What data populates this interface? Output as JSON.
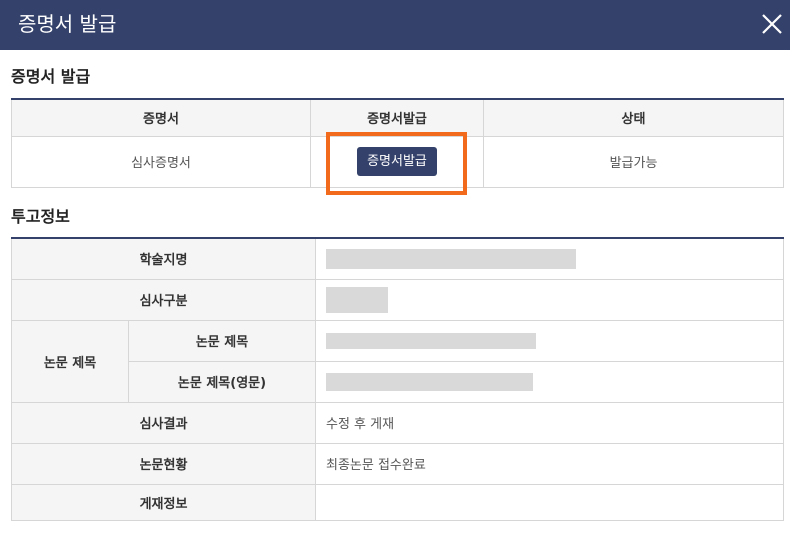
{
  "window": {
    "title": "증명서 발급",
    "close_icon": "close-icon"
  },
  "certificate_section": {
    "title": "증명서 발급",
    "headers": [
      "증명서",
      "증명서발급",
      "상태"
    ],
    "row": {
      "certificate": "심사증명서",
      "issue_button": "증명서발급",
      "status": "발급가능"
    },
    "highlight_color": "#f26a1b"
  },
  "submission_section": {
    "title": "투고정보",
    "labels": {
      "journal": "학술지명",
      "review_type": "심사구분",
      "paper_title": "논문 제목",
      "paper_title_kr": "논문 제목",
      "paper_title_en": "논문 제목(영문)",
      "review_result": "심사결과",
      "paper_status": "논문현황",
      "publication_info": "게재정보"
    },
    "values": {
      "review_result": "수정 후 게재",
      "paper_status": "최종논문 접수완료",
      "publication_info": ""
    }
  },
  "colors": {
    "header_bar": "#34426b",
    "button": "#34426b",
    "highlight": "#f26a1b"
  }
}
